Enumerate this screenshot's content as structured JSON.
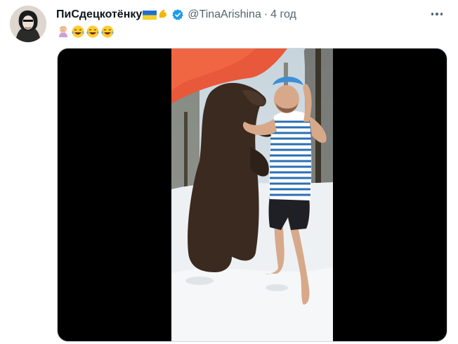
{
  "tweet": {
    "author_name": "ПиСдецкотёнку",
    "handle": "@TinaArishina",
    "separator": "·",
    "time": "4 год",
    "text_emojis": [
      "woman-facepalming",
      "face-with-tears-of-joy",
      "face-with-tears-of-joy",
      "face-with-tears-of-joy"
    ],
    "verified": true
  },
  "colors": {
    "name": "#0f1419",
    "secondary": "#536471",
    "verified": "#1d9bf0",
    "media_bg": "#000000"
  },
  "icons": [
    "flag-ukraine-icon",
    "flexed-biceps-icon",
    "verified-badge-icon",
    "more-options-icon"
  ],
  "media": {
    "type": "video",
    "description_hidden": true
  }
}
